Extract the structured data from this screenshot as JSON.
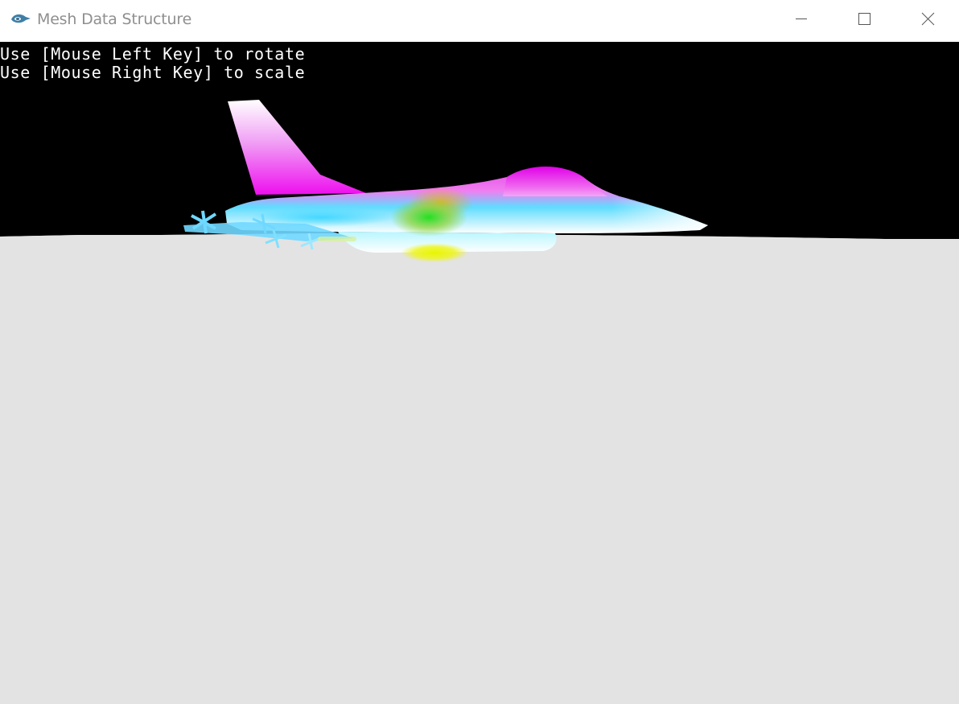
{
  "window": {
    "title": "Mesh Data Structure",
    "controls": {
      "minimize": "minimize-icon",
      "maximize": "maximize-icon",
      "close": "close-icon"
    }
  },
  "viewport": {
    "help_lines": [
      "Use [Mouse Left Key] to rotate",
      "Use [Mouse Right Key] to scale"
    ],
    "background_color": "#000000",
    "ground_color": "#e3e3e3",
    "text_color": "#ffffff",
    "model": "fighter-jet-mesh",
    "model_colors": [
      "#ff00ff",
      "#00ffff",
      "#00ff00",
      "#ffff00",
      "#ffffff"
    ]
  }
}
